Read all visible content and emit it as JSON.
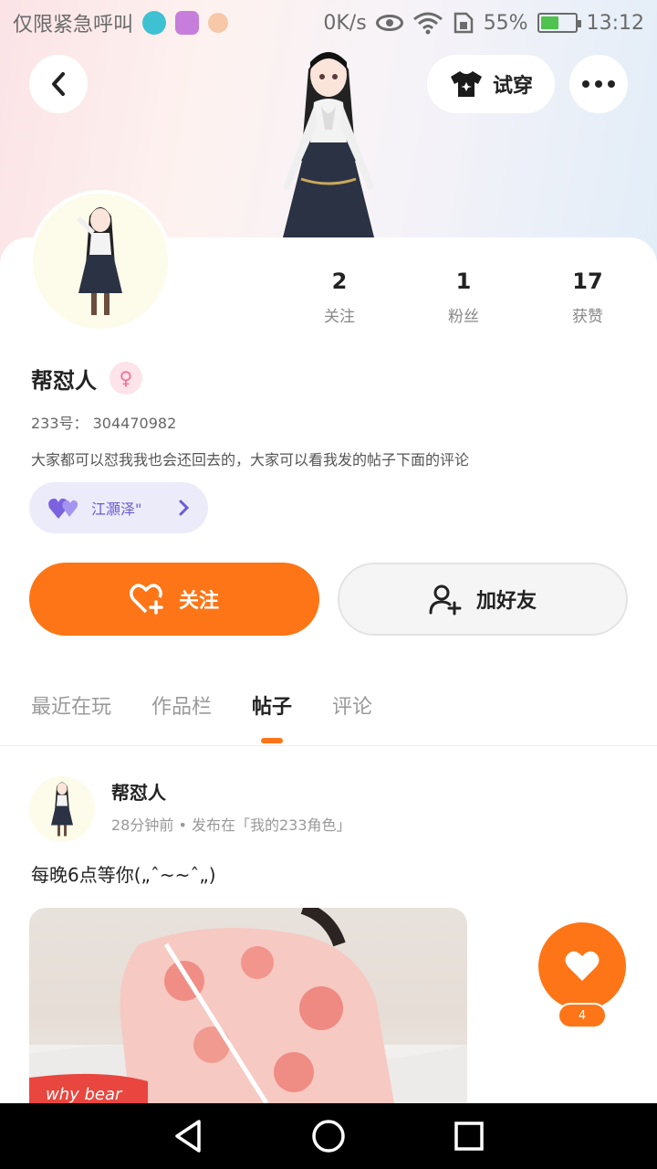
{
  "status_bar": {
    "carrier_text": "仅限紧急呼叫",
    "net_speed": "0K/s",
    "battery_percent": "55%",
    "time": "13:12",
    "battery_level": 0.55
  },
  "top_bar": {
    "try_on_label": "试穿"
  },
  "profile": {
    "stats": [
      {
        "value": "2",
        "label": "关注"
      },
      {
        "value": "1",
        "label": "粉丝"
      },
      {
        "value": "17",
        "label": "获赞"
      }
    ],
    "username": "帮怼人",
    "gender_symbol": "♀",
    "id_line": "233号：  304470982",
    "bio": "大家都可以怼我我也会还回去的，大家可以看我发的帖子下面的评论",
    "cp_name": "江灝泽\"",
    "colors": {
      "accent": "#fd7516",
      "cp_chip_bg": "#ecebfa",
      "cp_chip_text": "#6b5bd6"
    }
  },
  "actions": {
    "follow_label": "关注",
    "add_friend_label": "加好友"
  },
  "tabs": [
    {
      "label": "最近在玩",
      "active": false
    },
    {
      "label": "作品栏",
      "active": false
    },
    {
      "label": "帖子",
      "active": true
    },
    {
      "label": "评论",
      "active": false
    }
  ],
  "post": {
    "author": "帮怼人",
    "meta": "28分钟前 • 发布在「我的233角色」",
    "text": "每晚6点等你(„ˆ~~ˆ„)",
    "image_caption": "why bear",
    "like_count": "4"
  },
  "icons": {
    "back": "chevron-left-icon",
    "try_on": "tshirt-icon",
    "more": "more-dots-icon",
    "follow": "heart-plus-icon",
    "add_friend": "user-plus-icon",
    "like": "heart-icon"
  }
}
